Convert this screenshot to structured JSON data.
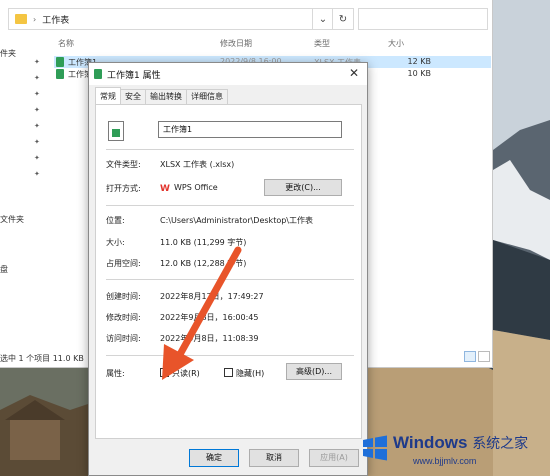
{
  "explorer": {
    "breadcrumb_sep": "›",
    "breadcrumb_folder": "工作表",
    "refresh_icon": "refresh-icon",
    "dropdown_icon": "chevron-down-icon",
    "columns": {
      "name": "名称",
      "date": "修改日期",
      "type": "类型",
      "size": "大小"
    },
    "files": [
      {
        "name": "工作簿1",
        "date": "2022/9/8 16:00",
        "type": "XLSX 工作表",
        "size": "12 KB",
        "selected": true
      },
      {
        "name": "工作簿1",
        "date": "",
        "type": "",
        "size": "10 KB",
        "selected": false
      }
    ],
    "sidebar": [
      "件夹",
      "文件夹",
      "盘"
    ],
    "status": "选中 1 个项目  11.0 KB"
  },
  "dialog": {
    "title": "工作簿1 属性",
    "close": "✕",
    "tabs": [
      "常规",
      "安全",
      "输出转换",
      "详细信息"
    ],
    "filename": "工作簿1",
    "file_type_label": "文件类型:",
    "file_type_value": "XLSX 工作表 (.xlsx)",
    "open_with_label": "打开方式:",
    "open_with_value": "WPS Office",
    "change_button": "更改(C)...",
    "location_label": "位置:",
    "location_value": "C:\\Users\\Administrator\\Desktop\\工作表",
    "size_label": "大小:",
    "size_value": "11.0 KB (11,299 字节)",
    "disk_size_label": "占用空间:",
    "disk_size_value": "12.0 KB (12,288 字节)",
    "created_label": "创建时间:",
    "created_value": "2022年8月17日，17:49:27",
    "modified_label": "修改时间:",
    "modified_value": "2022年9月8日，16:00:45",
    "accessed_label": "访问时间:",
    "accessed_value": "2022年9月8日，11:08:39",
    "attributes_label": "属性:",
    "readonly_label": "只读(R)",
    "hidden_label": "隐藏(H)",
    "advanced_button": "高级(D)...",
    "ok_button": "确定",
    "cancel_button": "取消",
    "apply_button": "应用(A)"
  },
  "watermark": {
    "brand": "Windows",
    "cn": "系统之家",
    "url": "www.bjjmlv.com"
  }
}
